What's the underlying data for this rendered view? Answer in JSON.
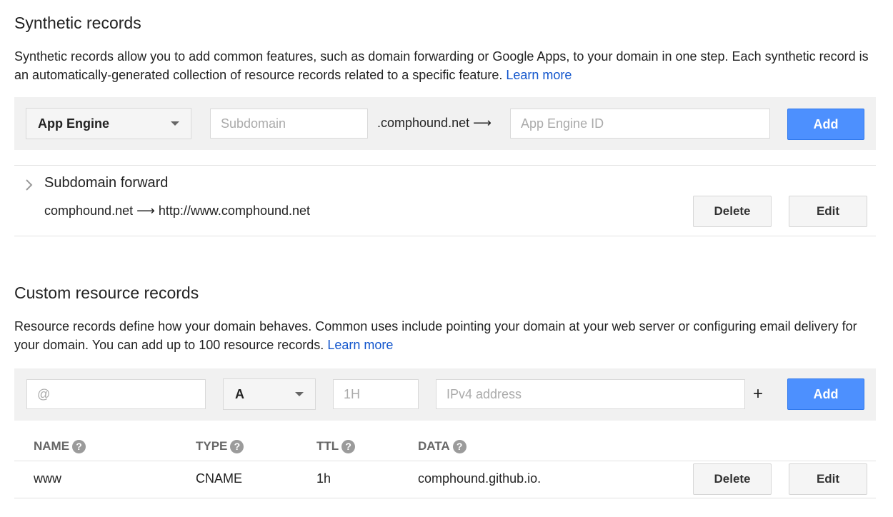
{
  "synthetic": {
    "title": "Synthetic records",
    "description": "Synthetic records allow you to add common features, such as domain forwarding or Google Apps, to your domain in one step. Each synthetic record is an automatically-generated collection of resource records related to a specific feature.",
    "learn_more": "Learn more",
    "form": {
      "type_selected": "App Engine",
      "subdomain_placeholder": "Subdomain",
      "domain_suffix": ".comphound.net ⟶",
      "app_id_placeholder": "App Engine ID",
      "add_label": "Add"
    },
    "records": [
      {
        "name": "Subdomain forward",
        "detail": "comphound.net ⟶ http://www.comphound.net",
        "delete_label": "Delete",
        "edit_label": "Edit"
      }
    ]
  },
  "custom": {
    "title": "Custom resource records",
    "description": "Resource records define how your domain behaves. Common uses include pointing your domain at your web server or configuring email delivery for your domain. You can add up to 100 resource records.",
    "learn_more": "Learn more",
    "form": {
      "name_placeholder": "@",
      "type_selected": "A",
      "ttl_placeholder": "1H",
      "data_placeholder": "IPv4 address",
      "plus": "+",
      "add_label": "Add"
    },
    "columns": [
      "NAME",
      "TYPE",
      "TTL",
      "DATA"
    ],
    "help_glyph": "?",
    "rows": [
      {
        "name": "www",
        "type": "CNAME",
        "ttl": "1h",
        "data": "comphound.github.io.",
        "delete_label": "Delete",
        "edit_label": "Edit"
      }
    ]
  }
}
